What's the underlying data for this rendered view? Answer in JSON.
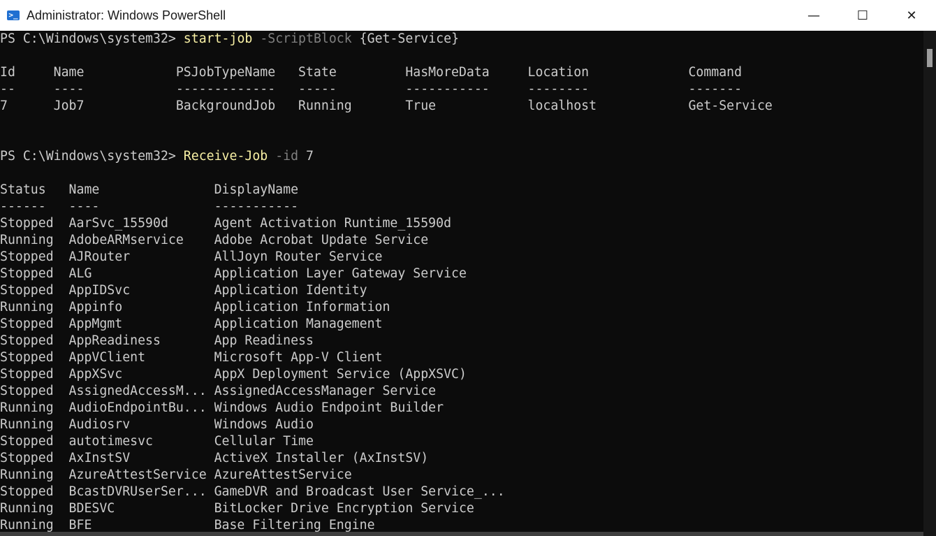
{
  "window": {
    "title": "Administrator: Windows PowerShell",
    "icon": "powershell-icon",
    "icon_glyph": ">_",
    "controls": {
      "minimize": "—",
      "maximize": "☐",
      "close": "✕"
    }
  },
  "session": {
    "prompt": "PS C:\\Windows\\system32> ",
    "command1": {
      "cmdlet": "start-job",
      "param": "-ScriptBlock",
      "arg": "{Get-Service}"
    },
    "jobs_table": {
      "headers": [
        "Id",
        "Name",
        "PSJobTypeName",
        "State",
        "HasMoreData",
        "Location",
        "Command"
      ],
      "underlines": [
        "--",
        "----",
        "-------------",
        "-----",
        "-----------",
        "--------",
        "-------"
      ],
      "rows": [
        [
          "7",
          "Job7",
          "BackgroundJob",
          "Running",
          "True",
          "localhost",
          "Get-Service"
        ]
      ]
    },
    "command2": {
      "cmdlet": "Receive-Job",
      "param": "-id",
      "arg": "7"
    },
    "services_table": {
      "headers": [
        "Status",
        "Name",
        "DisplayName"
      ],
      "underlines": [
        "------",
        "----",
        "-----------"
      ],
      "rows": [
        [
          "Stopped",
          "AarSvc_15590d",
          "Agent Activation Runtime_15590d"
        ],
        [
          "Running",
          "AdobeARMservice",
          "Adobe Acrobat Update Service"
        ],
        [
          "Stopped",
          "AJRouter",
          "AllJoyn Router Service"
        ],
        [
          "Stopped",
          "ALG",
          "Application Layer Gateway Service"
        ],
        [
          "Stopped",
          "AppIDSvc",
          "Application Identity"
        ],
        [
          "Running",
          "Appinfo",
          "Application Information"
        ],
        [
          "Stopped",
          "AppMgmt",
          "Application Management"
        ],
        [
          "Stopped",
          "AppReadiness",
          "App Readiness"
        ],
        [
          "Stopped",
          "AppVClient",
          "Microsoft App-V Client"
        ],
        [
          "Stopped",
          "AppXSvc",
          "AppX Deployment Service (AppXSVC)"
        ],
        [
          "Stopped",
          "AssignedAccessM...",
          "AssignedAccessManager Service"
        ],
        [
          "Running",
          "AudioEndpointBu...",
          "Windows Audio Endpoint Builder"
        ],
        [
          "Running",
          "Audiosrv",
          "Windows Audio"
        ],
        [
          "Stopped",
          "autotimesvc",
          "Cellular Time"
        ],
        [
          "Stopped",
          "AxInstSV",
          "ActiveX Installer (AxInstSV)"
        ],
        [
          "Running",
          "AzureAttestService",
          "AzureAttestService"
        ],
        [
          "Stopped",
          "BcastDVRUserSer...",
          "GameDVR and Broadcast User Service_..."
        ],
        [
          "Running",
          "BDESVC",
          "BitLocker Drive Encryption Service"
        ],
        [
          "Running",
          "BFE",
          "Base Filtering Engine"
        ]
      ]
    }
  },
  "colors": {
    "background": "#0c0c0c",
    "text": "#cccccc",
    "cmdlet": "#f9f1a5",
    "parameter": "#808080"
  }
}
